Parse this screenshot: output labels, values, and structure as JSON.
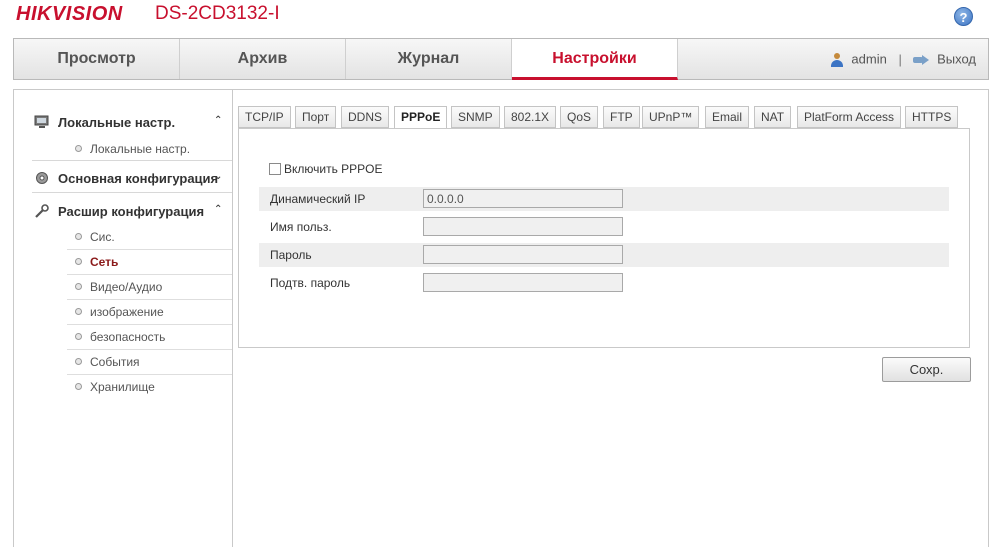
{
  "header": {
    "brand": "HIKVISION",
    "model": "DS-2CD3132-I",
    "help_label": "?"
  },
  "topnav": {
    "tabs": [
      {
        "label": "Просмотр",
        "active": false
      },
      {
        "label": "Архив",
        "active": false
      },
      {
        "label": "Журнал",
        "active": false
      },
      {
        "label": "Настройки",
        "active": true
      }
    ],
    "user": "admin",
    "separator": "|",
    "logout": "Выход"
  },
  "sidebar": {
    "sections": [
      {
        "label": "Локальные настр.",
        "icon": "monitor-icon",
        "expanded": true,
        "chevron": "⌃",
        "items": [
          {
            "label": "Локальные настр.",
            "active": false
          }
        ]
      },
      {
        "label": "Основная конфигурация",
        "icon": "gear-icon",
        "expanded": false,
        "chevron": "⌄",
        "items": []
      },
      {
        "label": "Расшир конфигурация",
        "icon": "wrench-icon",
        "expanded": true,
        "chevron": "⌃",
        "items": [
          {
            "label": "Сис.",
            "active": false
          },
          {
            "label": "Сеть",
            "active": true
          },
          {
            "label": "Видео/Аудио",
            "active": false
          },
          {
            "label": "изображение",
            "active": false
          },
          {
            "label": "безопасность",
            "active": false
          },
          {
            "label": "События",
            "active": false
          },
          {
            "label": "Хранилище",
            "active": false
          }
        ]
      }
    ]
  },
  "subtabs": [
    {
      "label": "TCP/IP",
      "active": false
    },
    {
      "label": "Порт",
      "active": false
    },
    {
      "label": "DDNS",
      "active": false
    },
    {
      "label": "PPPoE",
      "active": true
    },
    {
      "label": "SNMP",
      "active": false
    },
    {
      "label": "802.1X",
      "active": false
    },
    {
      "label": "QoS",
      "active": false
    },
    {
      "label": "FTP",
      "active": false
    },
    {
      "label": "UPnP™",
      "active": false
    },
    {
      "label": "Email",
      "active": false
    },
    {
      "label": "NAT",
      "active": false
    },
    {
      "label": "PlatForm Access",
      "active": false
    },
    {
      "label": "HTTPS",
      "active": false
    }
  ],
  "pppoe": {
    "enable_label": "Включить PPPOE",
    "enable_checked": false,
    "fields": [
      {
        "label": "Динамический IP",
        "value": "0.0.0.0"
      },
      {
        "label": "Имя польз.",
        "value": ""
      },
      {
        "label": "Пароль",
        "value": ""
      },
      {
        "label": "Подтв. пароль",
        "value": ""
      }
    ],
    "save_label": "Сохр."
  },
  "colors": {
    "brand_red": "#c8102e",
    "active_nav_red": "#8b1a1a"
  }
}
